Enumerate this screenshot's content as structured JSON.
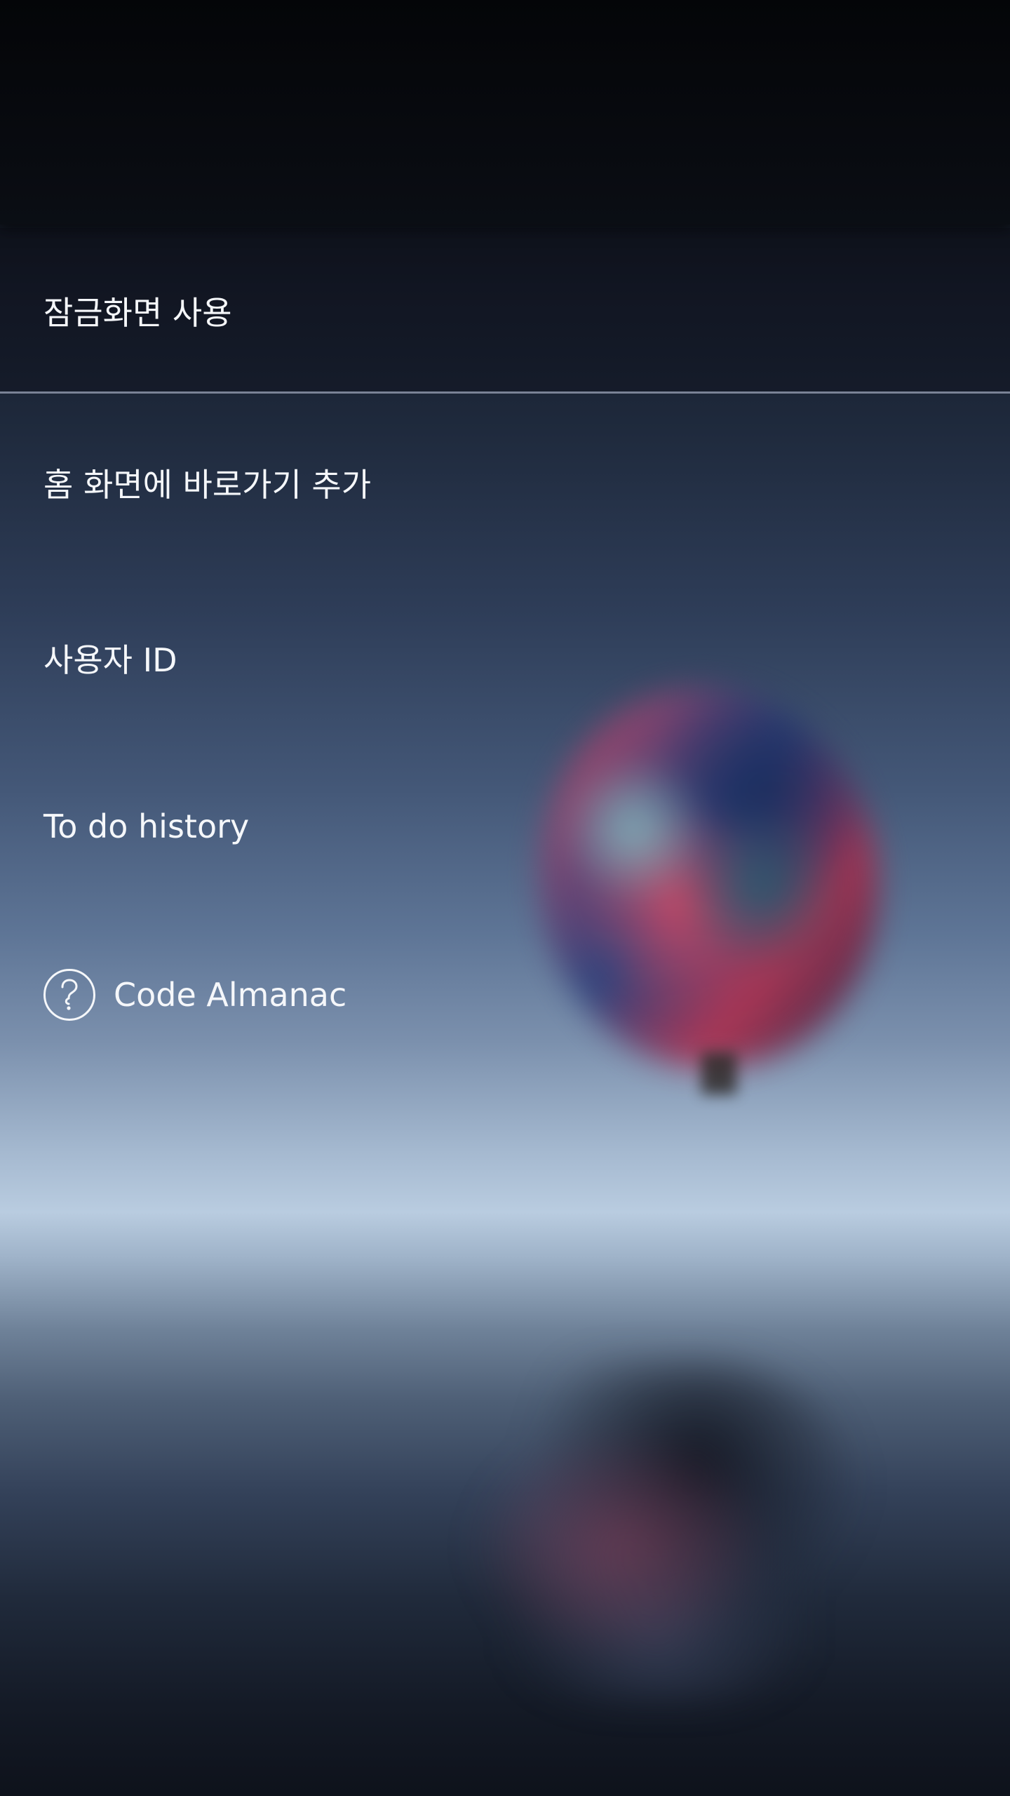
{
  "menu": {
    "items": [
      {
        "label": "잠금화면 사용"
      },
      {
        "label": "홈 화면에 바로가기 추가"
      },
      {
        "label": "사용자 ID"
      },
      {
        "label": "To do history"
      },
      {
        "label": "Code Almanac",
        "icon": "help-icon"
      }
    ]
  },
  "colors": {
    "text": "#f5f7fa",
    "divider": "#7a8296",
    "top_bar": "#05070b"
  }
}
